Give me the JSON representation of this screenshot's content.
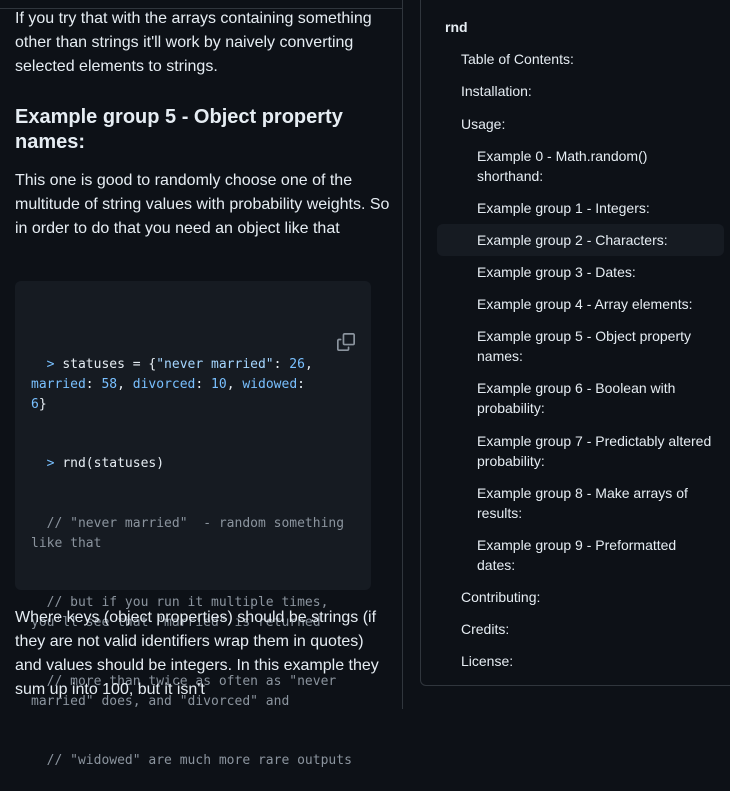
{
  "article": {
    "intro": "If you try that with the arrays containing something other than strings it'll work by naively converting selected elements to strings.",
    "heading": "Example group 5 - Object property names:",
    "para1": "This one is good to randomly choose one of the multitude of string values with probability weights. So in order to do that you need an object like that",
    "para2": "Where keys (object properties) should be strings (if they are not valid identifiers wrap them in quotes) and values should be integers. In this example they sum up into 100, but it isn't"
  },
  "code": {
    "copy_icon": "copy-icon",
    "line1_prompt": "  > ",
    "line1_a": "statuses = {",
    "line1_k1": "\"never married\"",
    "line1_b": ": ",
    "line1_n1": "26",
    "line1_c": ",",
    "line2_k2": "married",
    "line2_a": ": ",
    "line2_n2": "58",
    "line2_b": ", ",
    "line2_k3": "divorced",
    "line2_c": ": ",
    "line2_n3": "10",
    "line2_d": ", ",
    "line2_k4": "widowed",
    "line2_e": ":",
    "line3_n4": "6",
    "line3_a": "}",
    "line4_prompt": "  > ",
    "line4_a": "rnd(statuses)",
    "comment1": "  // \"never married\"  - random something like that",
    "comment2": "  // but if you run it multiple times, you'll see that \"married\" is returned",
    "comment3": "  // more than twice as often as \"never married\" does, and \"divorced\" and",
    "comment4": "  // \"widowed\" are much more rare outputs"
  },
  "toc": {
    "root": "rnd",
    "items_l1": [
      "Table of Contents:",
      "Installation:",
      "Usage:"
    ],
    "items_l2": [
      "Example 0 - Math.random() shorthand:",
      "Example group 1 - Integers:",
      "Example group 2 - Characters:",
      "Example group 3 - Dates:",
      "Example group 4 - Array elements:",
      "Example group 5 - Object property names:",
      "Example group 6 - Boolean with probability:",
      "Example group 7 - Predictably altered probability:",
      "Example group 8 - Make arrays of results:",
      "Example group 9 - Preformatted dates:"
    ],
    "items_l1_after": [
      "Contributing:",
      "Credits:",
      "License:"
    ]
  }
}
